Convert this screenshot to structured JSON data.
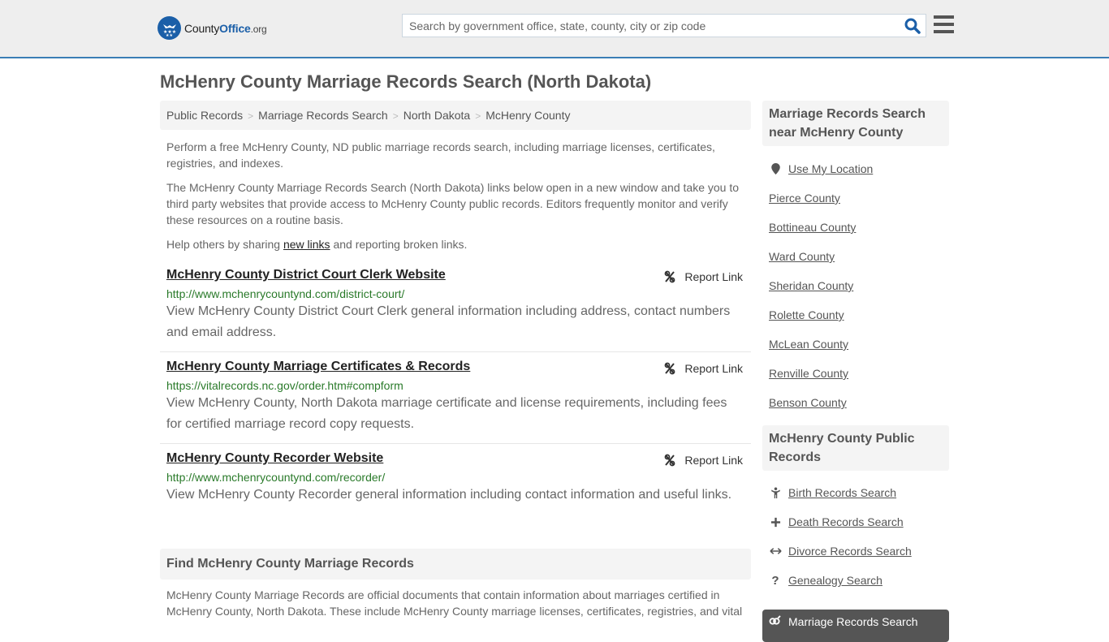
{
  "header": {
    "logo": {
      "name": "County",
      "brand": "Office",
      "tld": ".org"
    },
    "search": {
      "placeholder": "Search by government office, state, county, city or zip code",
      "value": ""
    },
    "search_icon": "search-icon",
    "menu_icon": "hamburger-menu-icon"
  },
  "page": {
    "title": "McHenry County Marriage Records Search (North Dakota)"
  },
  "breadcrumb": [
    {
      "label": "Public Records"
    },
    {
      "label": "Marriage Records Search"
    },
    {
      "label": "North Dakota"
    },
    {
      "label": "McHenry County"
    }
  ],
  "intro": {
    "p1": "Perform a free McHenry County, ND public marriage records search, including marriage licenses, certificates, registries, and indexes.",
    "p2": "The McHenry County Marriage Records Search (North Dakota) links below open in a new window and take you to third party websites that provide access to McHenry County public records. Editors frequently monitor and verify these resources on a routine basis.",
    "p3_before": "Help others by sharing ",
    "p3_link": "new links",
    "p3_after": " and reporting broken links."
  },
  "results": [
    {
      "title": "McHenry County District Court Clerk Website",
      "url": "http://www.mchenrycountynd.com/district-court/",
      "description": "View McHenry County District Court Clerk general information including address, contact numbers and email address.",
      "report_label": "Report Link"
    },
    {
      "title": "McHenry County Marriage Certificates & Records",
      "url": "https://vitalrecords.nc.gov/order.htm#compform",
      "description": "View McHenry County, North Dakota marriage certificate and license requirements, including fees for certified marriage record copy requests.",
      "report_label": "Report Link"
    },
    {
      "title": "McHenry County Recorder Website",
      "url": "http://www.mchenrycountynd.com/recorder/",
      "description": "View McHenry County Recorder general information including contact information and useful links.",
      "report_label": "Report Link"
    }
  ],
  "find": {
    "heading": "Find McHenry County Marriage Records",
    "text": "McHenry County Marriage Records are official documents that contain information about marriages certified in McHenry County, North Dakota. These include McHenry County marriage licenses, certificates, registries, and vital"
  },
  "sidebar": {
    "nearby": {
      "heading": "Marriage Records Search near McHenry County",
      "use_location": "Use My Location",
      "counties": [
        "Pierce County",
        "Bottineau County",
        "Ward County",
        "Sheridan County",
        "Rolette County",
        "McLean County",
        "Renville County",
        "Benson County"
      ]
    },
    "public_records": {
      "heading": "McHenry County Public Records",
      "items": [
        {
          "label": "Birth Records Search",
          "icon": "child-icon"
        },
        {
          "label": "Death Records Search",
          "icon": "plus-icon"
        },
        {
          "label": "Divorce Records Search",
          "icon": "arrows-horizontal-icon"
        },
        {
          "label": "Genealogy Search",
          "icon": "question-icon"
        }
      ],
      "active": {
        "label": "Marriage Records Search",
        "icon": "marriage-rings-icon"
      }
    }
  },
  "colors": {
    "brand_blue": "#1b5fa8",
    "header_border": "#3a7eb5",
    "url_green": "#2a7a2a",
    "active_bg": "#555555"
  }
}
